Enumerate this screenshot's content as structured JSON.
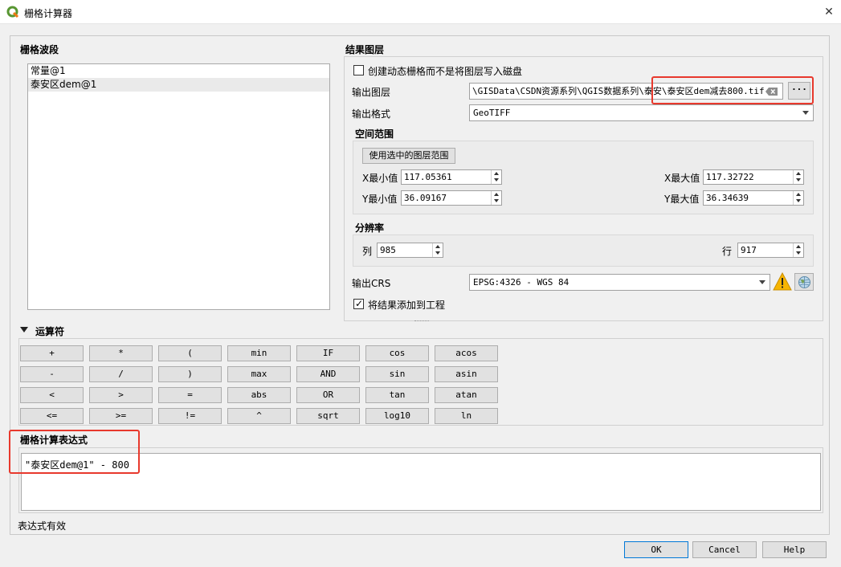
{
  "window": {
    "title": "栅格计算器",
    "close_label": "✕"
  },
  "bands": {
    "label": "栅格波段",
    "items": [
      "常量@1",
      "泰安区dem@1"
    ]
  },
  "result": {
    "label": "结果图层",
    "dynamic_checkbox_label": "创建动态栅格而不是将图层写入磁盘",
    "output_layer_label": "输出图层",
    "output_layer_value": "\\GISData\\CSDN资源系列\\QGIS数据系列\\泰安\\泰安区dem减去800.tif",
    "browse_label": "···",
    "output_format_label": "输出格式",
    "output_format_value": "GeoTIFF",
    "extent": {
      "label": "空间范围",
      "use_selected_button": "使用选中的图层范围",
      "xmin_label": "X最小值",
      "xmin": "117.05361",
      "xmax_label": "X最大值",
      "xmax": "117.32722",
      "ymin_label": "Y最小值",
      "ymin": "36.09167",
      "ymax_label": "Y最大值",
      "ymax": "36.34639"
    },
    "resolution": {
      "label": "分辨率",
      "cols_label": "列",
      "cols": "985",
      "rows_label": "行",
      "rows": "917"
    },
    "crs_label": "输出CRS",
    "crs_value": "EPSG:4326 - WGS 84",
    "add_to_project_label": "将结果添加到工程"
  },
  "operators": {
    "label": "运算符",
    "rows": [
      [
        "+",
        "*",
        "(",
        "min",
        "IF",
        "cos",
        "acos"
      ],
      [
        "-",
        "/",
        ")",
        "max",
        "AND",
        "sin",
        "asin"
      ],
      [
        "<",
        ">",
        "=",
        "abs",
        "OR",
        "tan",
        "atan"
      ],
      [
        "<=",
        ">=",
        "!=",
        "^",
        "sqrt",
        "log10",
        "ln"
      ]
    ]
  },
  "expression": {
    "label": "栅格计算表达式",
    "value": "\"泰安区dem@1\" - 800",
    "status": "表达式有效"
  },
  "buttons": {
    "ok": "OK",
    "cancel": "Cancel",
    "help": "Help"
  },
  "colors": {
    "highlight_red": "#e8392d",
    "qgis_green": "#589632",
    "warning_yellow": "#f7b500"
  }
}
